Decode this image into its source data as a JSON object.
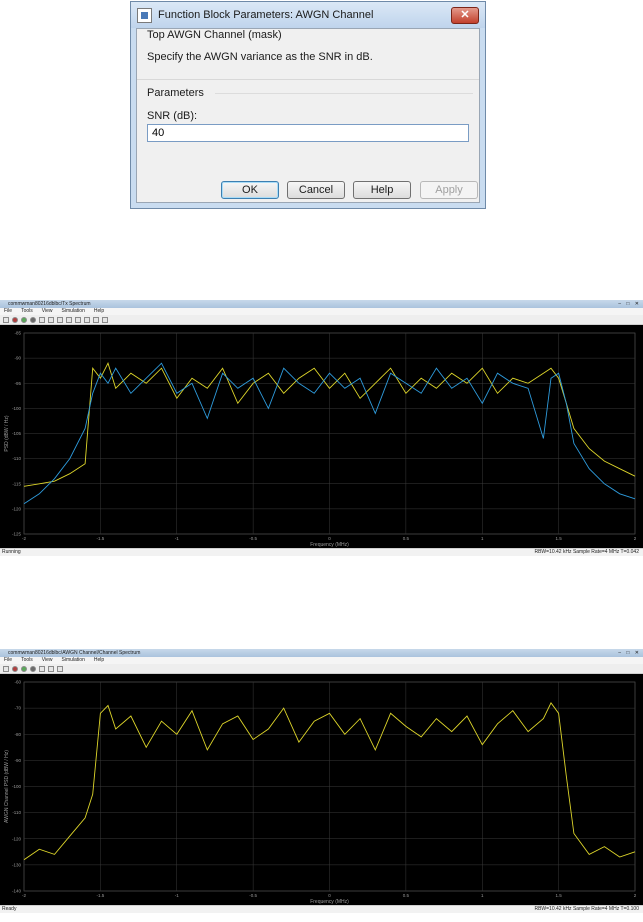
{
  "dialog": {
    "title": "Function Block Parameters: AWGN Channel",
    "close_label": "✕",
    "mask_title": "Top AWGN Channel (mask)",
    "mask_description": "Specify the AWGN variance as the SNR in dB.",
    "parameters_title": "Parameters",
    "snr_label": "SNR (dB):",
    "snr_value": "40",
    "buttons": {
      "ok": "OK",
      "cancel": "Cancel",
      "help": "Help",
      "apply": "Apply"
    }
  },
  "scopes": [
    {
      "title": "commwman80216dblbc/Tx Spectrum",
      "menu": [
        "File",
        "Tools",
        "View",
        "Simulation",
        "Help"
      ],
      "status_left": "Running",
      "status_right": "RBW=10.42 kHz   Sample Rate=4 MHz   T=0.042",
      "ylabel": "PSD (dBW / Hz)",
      "xlabel": "Frequency (MHz)"
    },
    {
      "title": "commwman80216dblbc/AWGN Channel/Channel Spectrum",
      "menu": [
        "File",
        "Tools",
        "View",
        "Simulation",
        "Help"
      ],
      "status_left": "Ready",
      "status_right": "RBW=10.42 kHz   Sample Rate=4 MHz   T=0.100",
      "ylabel": "AWGN Channel PSD (dBW / Hz)",
      "xlabel": "Frequency (MHz)"
    }
  ],
  "chart_data": [
    {
      "type": "line",
      "xlabel": "Frequency (MHz)",
      "ylabel": "PSD (dBW / Hz)",
      "xlim": [
        -2,
        2
      ],
      "ylim": [
        -125,
        -85
      ],
      "x_ticks": [
        "-2",
        "-1.5",
        "-1",
        "-0.5",
        "0",
        "0.5",
        "1",
        "1.5",
        "2"
      ],
      "y_ticks": [
        "-85",
        "-90",
        "-95",
        "-100",
        "-105",
        "-110",
        "-115",
        "-120",
        "-125"
      ],
      "grid": true,
      "colors": [
        "#ddd52a",
        "#2e9bdc"
      ],
      "series": [
        {
          "x": [
            -2,
            -1.9,
            -1.8,
            -1.7,
            -1.6,
            -1.55,
            -1.5,
            -1.45,
            -1.4,
            -1.3,
            -1.2,
            -1.1,
            -1,
            -0.9,
            -0.8,
            -0.7,
            -0.6,
            -0.5,
            -0.4,
            -0.3,
            -0.2,
            -0.1,
            0,
            0.1,
            0.2,
            0.3,
            0.4,
            0.5,
            0.6,
            0.7,
            0.8,
            0.9,
            1,
            1.1,
            1.2,
            1.3,
            1.4,
            1.45,
            1.5,
            1.55,
            1.6,
            1.7,
            1.8,
            1.9,
            2
          ],
          "y": [
            -115.5,
            -115,
            -114.5,
            -113,
            -111,
            -92,
            -94,
            -91,
            -96,
            -93,
            -95,
            -92,
            -98,
            -94,
            -96,
            -92,
            -99,
            -95,
            -93,
            -97,
            -94,
            -92,
            -96,
            -93,
            -98,
            -95,
            -92,
            -97,
            -94,
            -96,
            -93,
            -95,
            -92,
            -97,
            -94,
            -95,
            -93,
            -92,
            -94,
            -99,
            -104,
            -108,
            -110.5,
            -112,
            -113.5
          ]
        },
        {
          "x": [
            -2,
            -1.9,
            -1.8,
            -1.7,
            -1.6,
            -1.55,
            -1.5,
            -1.45,
            -1.4,
            -1.3,
            -1.2,
            -1.1,
            -1,
            -0.9,
            -0.8,
            -0.7,
            -0.6,
            -0.5,
            -0.4,
            -0.3,
            -0.2,
            -0.1,
            0,
            0.1,
            0.2,
            0.3,
            0.4,
            0.5,
            0.6,
            0.7,
            0.8,
            0.9,
            1,
            1.1,
            1.2,
            1.3,
            1.4,
            1.45,
            1.5,
            1.55,
            1.6,
            1.7,
            1.8,
            1.9,
            2
          ],
          "y": [
            -119,
            -117,
            -114,
            -110,
            -104,
            -97,
            -93,
            -95,
            -92,
            -97,
            -94,
            -91,
            -97,
            -95,
            -102,
            -93,
            -96,
            -94,
            -100,
            -92,
            -95,
            -97,
            -93,
            -96,
            -94,
            -101,
            -93,
            -95,
            -97,
            -92,
            -96,
            -94,
            -99,
            -93,
            -95,
            -96,
            -106,
            -94,
            -93,
            -99,
            -107,
            -112,
            -115,
            -117,
            -118
          ]
        }
      ]
    },
    {
      "type": "line",
      "xlabel": "Frequency (MHz)",
      "ylabel": "AWGN Channel PSD (dBW / Hz)",
      "xlim": [
        -2,
        2
      ],
      "ylim": [
        -140,
        -60
      ],
      "x_ticks": [
        "-2",
        "-1.5",
        "-1",
        "-0.5",
        "0",
        "0.5",
        "1",
        "1.5",
        "2"
      ],
      "y_ticks": [
        "-60",
        "-70",
        "-80",
        "-90",
        "-100",
        "-110",
        "-120",
        "-130",
        "-140"
      ],
      "grid": true,
      "colors": [
        "#ddd52a"
      ],
      "series": [
        {
          "x": [
            -2,
            -1.9,
            -1.8,
            -1.7,
            -1.6,
            -1.55,
            -1.5,
            -1.45,
            -1.4,
            -1.3,
            -1.2,
            -1.1,
            -1,
            -0.9,
            -0.8,
            -0.7,
            -0.6,
            -0.5,
            -0.4,
            -0.3,
            -0.2,
            -0.1,
            0,
            0.1,
            0.2,
            0.3,
            0.4,
            0.5,
            0.6,
            0.7,
            0.8,
            0.9,
            1,
            1.1,
            1.2,
            1.3,
            1.4,
            1.45,
            1.5,
            1.55,
            1.6,
            1.7,
            1.8,
            1.9,
            2
          ],
          "y": [
            -128,
            -124,
            -126,
            -119,
            -112,
            -103,
            -72,
            -69,
            -78,
            -73,
            -85,
            -75,
            -80,
            -71,
            -86,
            -76,
            -73,
            -82,
            -78,
            -70,
            -83,
            -75,
            -72,
            -80,
            -74,
            -86,
            -72,
            -77,
            -81,
            -74,
            -79,
            -73,
            -84,
            -76,
            -71,
            -79,
            -74,
            -68,
            -72,
            -96,
            -118,
            -126,
            -123,
            -127,
            -125
          ]
        }
      ]
    }
  ]
}
